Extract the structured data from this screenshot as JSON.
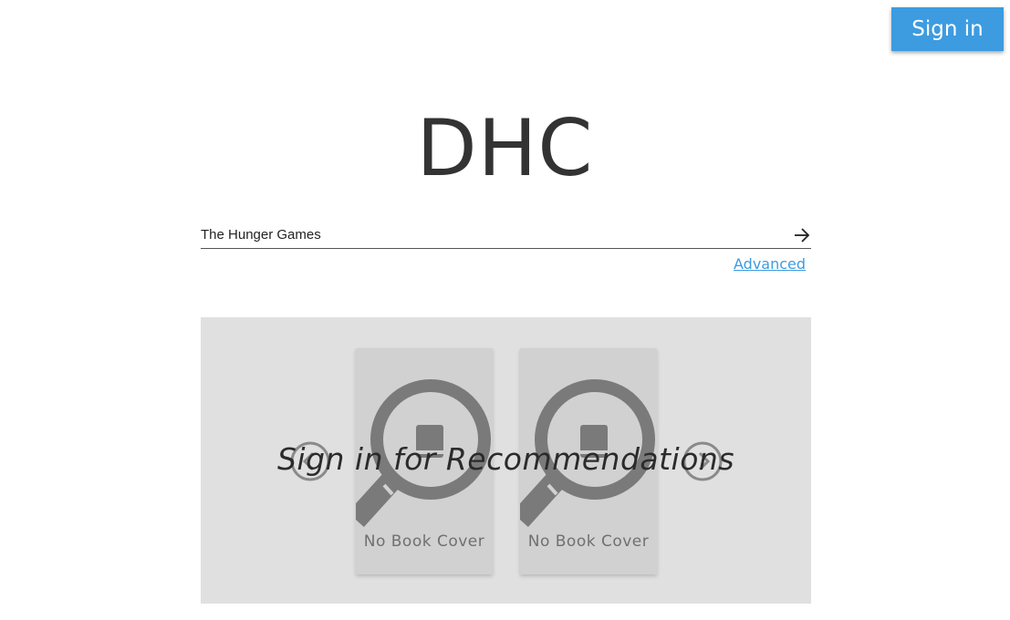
{
  "header": {
    "signin_label": "Sign in"
  },
  "logo": {
    "text": "DHC"
  },
  "search": {
    "value": "The Hunger Games",
    "advanced_label": "Advanced",
    "submit_icon": "arrow-right-icon"
  },
  "recommendations": {
    "overlay_text": "Sign in for Recommendations",
    "prev_icon": "chevron-left-icon",
    "next_icon": "chevron-right-icon",
    "books": [
      {
        "cover_label": "No Book Cover",
        "icon": "magnifier-book-icon"
      },
      {
        "cover_label": "No Book Cover",
        "icon": "magnifier-book-icon"
      }
    ]
  },
  "colors": {
    "accent": "#3d9be0",
    "panel_bg": "#e0e0e0",
    "card_bg": "#d0d1d0",
    "icon_gray": "#7a7a7a",
    "text_dark": "#333333"
  }
}
